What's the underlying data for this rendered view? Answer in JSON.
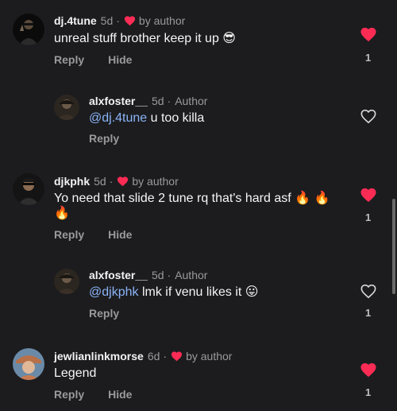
{
  "comments": [
    {
      "username": "dj.4tune",
      "age": "5d",
      "author_like": "by author",
      "text": "unreal stuff brother keep it up",
      "emoji": "😎",
      "reply_label": "Reply",
      "hide_label": "Hide",
      "likes": "1",
      "liked": true
    },
    {
      "username": "alxfoster__",
      "age": "5d",
      "author_tag": "Author",
      "mention": "@dj.4tune",
      "text": "u too killa",
      "reply_label": "Reply",
      "likes": "",
      "liked": false
    },
    {
      "username": "djkphk",
      "age": "5d",
      "author_like": "by author",
      "text": "Yo need that slide 2 tune rq that's hard asf",
      "emoji": "🔥 🔥",
      "emoji_line2": "🔥",
      "reply_label": "Reply",
      "hide_label": "Hide",
      "likes": "1",
      "liked": true
    },
    {
      "username": "alxfoster__",
      "age": "5d",
      "author_tag": "Author",
      "mention": "@djkphk",
      "text": "lmk if venu likes it",
      "emoji": "😛",
      "reply_label": "Reply",
      "likes": "1",
      "liked": false
    },
    {
      "username": "jewlianlinkmorse",
      "age": "6d",
      "author_like": "by author",
      "text": "Legend",
      "reply_label": "Reply",
      "hide_label": "Hide",
      "likes": "1",
      "liked": true
    }
  ],
  "colors": {
    "background": "#1c1c1e",
    "heart_red": "#fe2c55",
    "mention_blue": "#8ab4f8",
    "muted": "#9a9a9e"
  },
  "icons": {
    "liked": "filled-heart-icon",
    "unliked": "outline-heart-icon",
    "author_heart": "red-heart-icon"
  }
}
